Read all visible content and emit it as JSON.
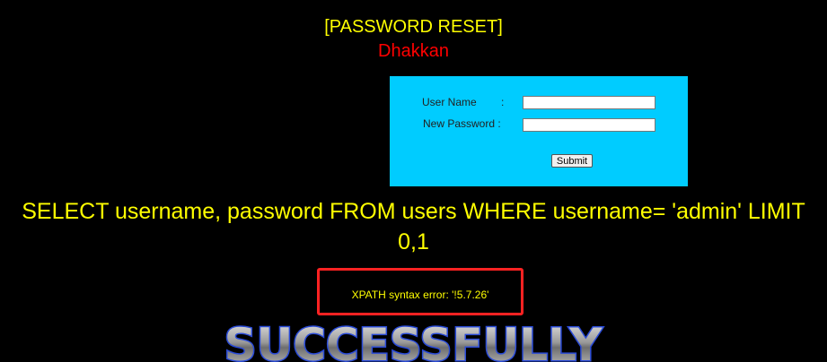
{
  "header": {
    "title": "[PASSWORD RESET]",
    "subtitle": "Dhakkan"
  },
  "form": {
    "username_label": "User Name",
    "username_colon": ":",
    "password_label": "New Password :",
    "username_value": "",
    "password_value": "",
    "submit_label": "Submit",
    "background_color": "#00ccff"
  },
  "query": {
    "text": "SELECT username, password FROM users WHERE username= 'admin' LIMIT 0,1"
  },
  "error": {
    "message": "XPATH syntax error: '!5.7.26'",
    "border_color": "#ff2222"
  },
  "banner": {
    "text": "SUCCESSFULLY"
  }
}
